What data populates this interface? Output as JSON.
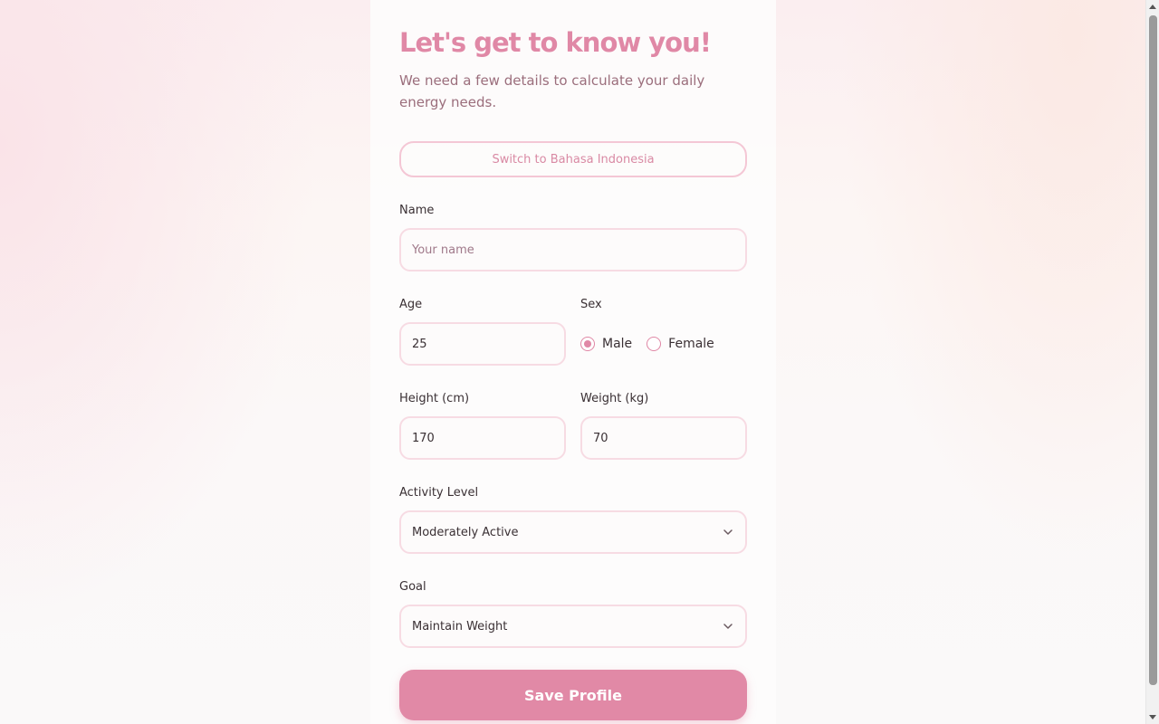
{
  "header": {
    "title": "Let's get to know you!",
    "subtitle": "We need a few details to calculate your daily energy needs."
  },
  "language_toggle": {
    "label": "Switch to Bahasa Indonesia"
  },
  "form": {
    "name": {
      "label": "Name",
      "placeholder": "Your name",
      "value": ""
    },
    "age": {
      "label": "Age",
      "value": "25"
    },
    "sex": {
      "label": "Sex",
      "options": [
        {
          "label": "Male",
          "selected": true
        },
        {
          "label": "Female",
          "selected": false
        }
      ]
    },
    "height": {
      "label": "Height (cm)",
      "value": "170"
    },
    "weight": {
      "label": "Weight (kg)",
      "value": "70"
    },
    "activity": {
      "label": "Activity Level",
      "value": "Moderately Active"
    },
    "goal": {
      "label": "Goal",
      "value": "Maintain Weight"
    },
    "submit_label": "Save Profile"
  },
  "colors": {
    "accent": "#e088a6",
    "button": "#e189a6",
    "border": "#f7dbe3"
  },
  "icons": {
    "select_arrow": "chevron-down-icon"
  }
}
